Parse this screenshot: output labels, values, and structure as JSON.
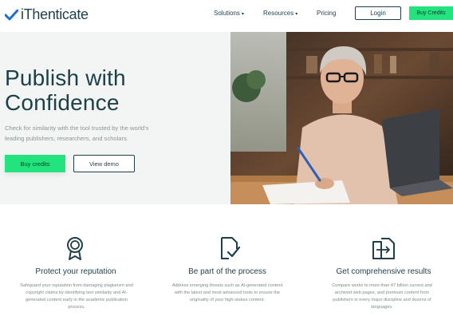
{
  "header": {
    "logo_text": "iThenticate",
    "nav": [
      {
        "label": "Solutions",
        "has_dropdown": true
      },
      {
        "label": "Resources",
        "has_dropdown": true
      },
      {
        "label": "Pricing",
        "has_dropdown": false
      }
    ],
    "login_label": "Login",
    "buy_label": "Buy Credits"
  },
  "hero": {
    "title_line1": "Publish with",
    "title_line2": "Confidence",
    "subtitle_line1": "Check for similarity with the tool trusted by the world's",
    "subtitle_line2": "leading publishers, researchers, and scholars.",
    "buy_label": "Buy credits",
    "demo_label": "View demo"
  },
  "features": [
    {
      "icon": "award-ribbon-icon",
      "title": "Protect your reputation",
      "desc_lines": [
        "Safeguard your reputation from damaging plagiarism and",
        "copyright claims by identifying text similarity and AI-",
        "generated content early in the academic publication",
        "process."
      ]
    },
    {
      "icon": "document-check-icon",
      "title": "Be part of the process",
      "desc_lines": [
        "Address emerging threats such as AI-generated content",
        "with the latest and most advanced tools to ensure the",
        "originality of your high-stakes content."
      ]
    },
    {
      "icon": "documents-compare-icon",
      "title": "Get comprehensive results",
      "desc_lines": [
        "Compare works to more than 47 billion current and",
        "archived web pages, and premium content from",
        "publishers in every major discipline and dozens of",
        "languages."
      ]
    }
  ],
  "colors": {
    "brand_navy": "#1f3f4a",
    "accent_green": "#22e37e",
    "hero_bg": "#f2f5f4"
  }
}
